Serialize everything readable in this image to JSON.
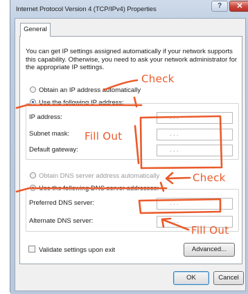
{
  "window": {
    "title": "Internet Protocol Version 4 (TCP/IPv4) Properties",
    "help_label": "?",
    "close_label": "✕"
  },
  "tabs": [
    {
      "label": "General"
    }
  ],
  "intro_text": "You can get IP settings assigned automatically if your network supports this capability. Otherwise, you need to ask your network administrator for the appropriate IP settings.",
  "ip_section": {
    "auto_option": "Obtain an IP address automatically",
    "manual_option": "Use the following IP address:",
    "selected": "manual",
    "fields": [
      {
        "label": "IP address:",
        "value": ".   .   ."
      },
      {
        "label": "Subnet mask:",
        "value": ".   .   ."
      },
      {
        "label": "Default gateway:",
        "value": ".   .   ."
      }
    ]
  },
  "dns_section": {
    "auto_option": "Obtain DNS server address automatically",
    "manual_option": "Use the following DNS server addresses:",
    "selected": "manual",
    "fields": [
      {
        "label": "Preferred DNS server:",
        "value": ".   .   ."
      },
      {
        "label": "Alternate DNS server:",
        "value": ".   .   ."
      }
    ]
  },
  "validate_label": "Validate settings upon exit",
  "buttons": {
    "advanced": "Advanced...",
    "ok": "OK",
    "cancel": "Cancel"
  },
  "annotations": {
    "check_1": "Check",
    "check_2": "Check",
    "fill_out_1": "Fill Out",
    "fill_out_2": "Fill Out",
    "color": "#ea5a2a"
  }
}
